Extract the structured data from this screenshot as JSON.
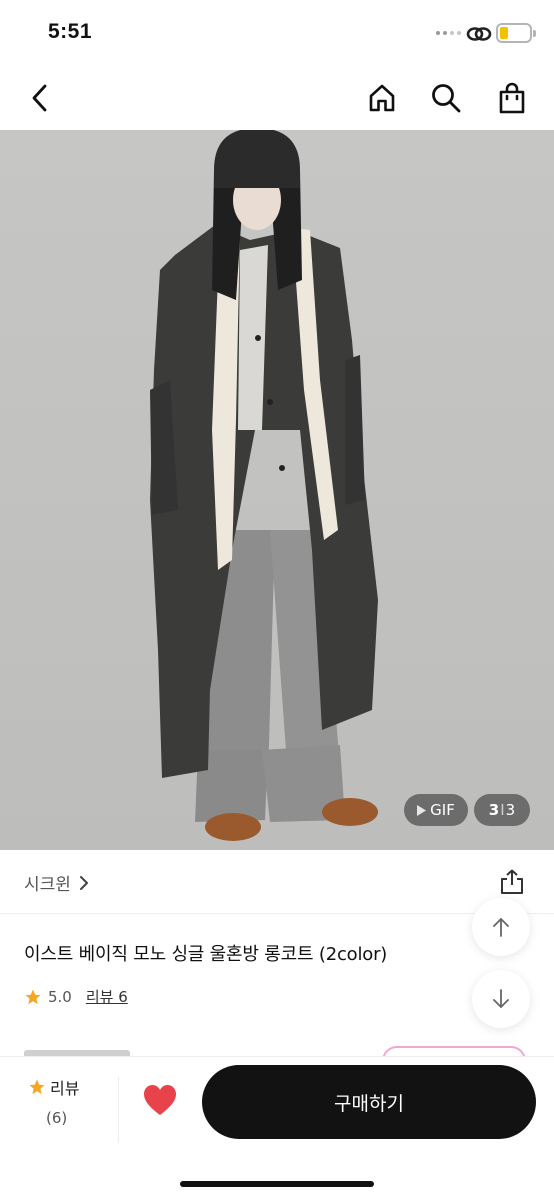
{
  "status_bar": {
    "time": "5:51"
  },
  "nav": {
    "back_icon": "chevron-left-icon",
    "home_icon": "home-icon",
    "search_icon": "search-icon",
    "cart_icon": "shopping-bag-icon"
  },
  "gallery": {
    "gif_label": "GIF",
    "current_page": "3",
    "page_separator": "I",
    "total_pages": "3"
  },
  "brand": {
    "name": "시크윈"
  },
  "product": {
    "title": "이스트 베이직 모노 싱글 울혼방 롱코트 (2color)",
    "rating": "5.0",
    "review_link": "리뷰 6"
  },
  "bottom_bar": {
    "review_label": "리뷰",
    "review_count": "(6)",
    "buy_label": "구매하기"
  },
  "colors": {
    "accent_star": "#f5a623",
    "heart": "#e8434b",
    "buy_button": "#121212",
    "battery": "#f2c200"
  }
}
